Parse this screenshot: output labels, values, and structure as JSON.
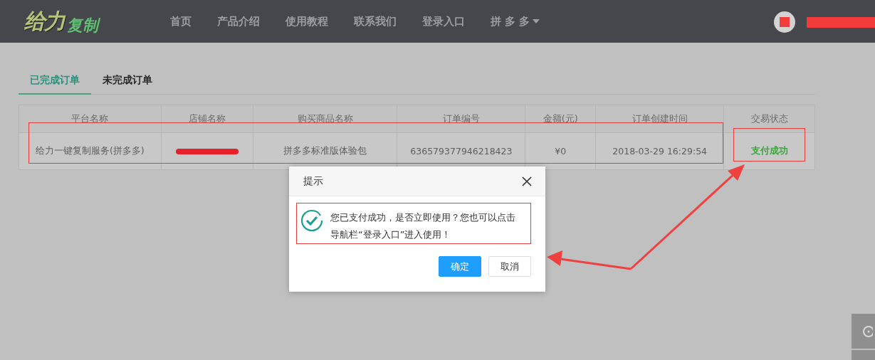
{
  "header": {
    "logo": {
      "part_1": "给力",
      "part_2": "复制"
    },
    "nav": [
      {
        "label": "首页",
        "kind": "link"
      },
      {
        "label": "产品介绍",
        "kind": "link"
      },
      {
        "label": "使用教程",
        "kind": "link"
      },
      {
        "label": "联系我们",
        "kind": "link"
      },
      {
        "label": "登录入口",
        "kind": "link"
      },
      {
        "label": "拼 多 多",
        "kind": "dropdown"
      }
    ]
  },
  "tabs": [
    {
      "label": "已完成订单",
      "selected": true
    },
    {
      "label": "未完成订单",
      "selected": false
    }
  ],
  "table": {
    "columns": [
      "平台名称",
      "店铺名称",
      "购买商品名称",
      "订单编号",
      "金额(元)",
      "订单创建时间",
      "交易状态"
    ],
    "rows": [
      {
        "cells": [
          {
            "text": "给力一键复制服务(拼多多)",
            "kind": "text"
          },
          {
            "kind": "redacted"
          },
          {
            "text": "拼多多标准版体验包",
            "kind": "text"
          },
          {
            "text": "636579377946218423",
            "kind": "text"
          },
          {
            "text": "¥0",
            "kind": "text"
          },
          {
            "text": "2018-03-29 16:29:54",
            "kind": "text"
          },
          {
            "text": "支付成功",
            "kind": "status"
          }
        ]
      }
    ]
  },
  "dialog": {
    "title": "提示",
    "message": "您已支付成功，是否立即使用？您也可以点击导航栏“登录入口”进入使用！",
    "buttons": [
      {
        "label": "确定",
        "kind": "primary"
      },
      {
        "label": "取消",
        "kind": "secondary"
      }
    ]
  }
}
